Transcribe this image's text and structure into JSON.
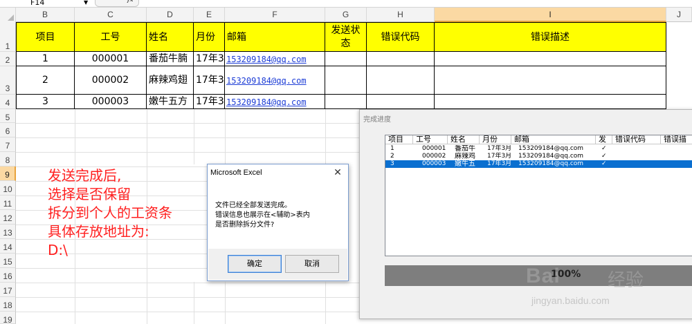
{
  "formula_bar": {
    "name_box": "F14",
    "fx_label": "fx"
  },
  "columns": [
    "B",
    "C",
    "D",
    "E",
    "F",
    "G",
    "H",
    "I",
    "J"
  ],
  "rows": [
    "1",
    "2",
    "3",
    "4",
    "5",
    "6",
    "7",
    "8",
    "9",
    "10",
    "11",
    "12",
    "13",
    "14",
    "15",
    "16",
    "17",
    "18",
    "19"
  ],
  "selected_row": "9",
  "selected_column": "I",
  "table": {
    "headers": [
      "项目",
      "工号",
      "姓名",
      "月份",
      "邮箱",
      "发送状态",
      "错误代码",
      "错误描述"
    ],
    "header_status_line1": "发送状",
    "header_status_line2": "态",
    "rows": [
      {
        "item": "1",
        "id": "000001",
        "name": "番茄牛腩",
        "month": "17年3",
        "email": "153209184@qq.com"
      },
      {
        "item": "2",
        "id": "000002",
        "name": "麻辣鸡翅",
        "month": "17年3",
        "email": "153209184@qq.com"
      },
      {
        "item": "3",
        "id": "000003",
        "name": "嫩牛五方",
        "month": "17年3",
        "email": "153209184@qq.com"
      }
    ]
  },
  "annotation": {
    "lines": [
      "发送完成后,",
      "选择是否保留",
      "拆分到个人的工资条",
      "具体存放地址为:",
      "D:\\"
    ]
  },
  "message_box": {
    "title": "Microsoft Excel",
    "close": "✕",
    "lines": [
      "文件已经全部发送完成。",
      "错误信息也展示在<辅助>表内",
      "是否删除拆分文件?"
    ],
    "ok_label": "确定",
    "cancel_label": "取消"
  },
  "progress_dialog": {
    "title": "完成进度",
    "columns": [
      "项目",
      "工号",
      "姓名",
      "月份",
      "邮箱",
      "发",
      "错误代码",
      "错误描"
    ],
    "rows": [
      {
        "item": "1",
        "id": "000001",
        "name": "番茄牛",
        "month": "17年3月",
        "email": "153209184@qq.com",
        "status": "✓"
      },
      {
        "item": "2",
        "id": "000002",
        "name": "麻辣鸡",
        "month": "17年3月",
        "email": "153209184@qq.com",
        "status": "✓"
      },
      {
        "item": "3",
        "id": "000003",
        "name": "嫩牛五",
        "month": "17年3月",
        "email": "153209184@qq.com",
        "status": "✓"
      }
    ],
    "selected_row_index": 2,
    "progress_label": "100%",
    "progress_fraction": 1.0
  },
  "watermark": {
    "logo": "Bai",
    "logo_cn": "经验",
    "url": "jingyan.baidu.com"
  }
}
